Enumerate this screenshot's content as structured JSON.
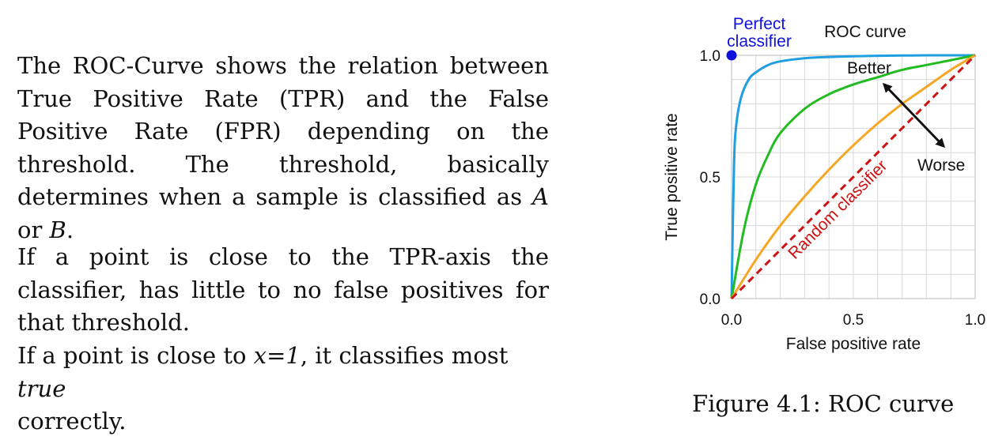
{
  "text": {
    "para1": "The ROC-Curve shows the relation between True Positive Rate (TPR) and the False Positive Rate (FPR) depending on the threshold. The threshold, basically determines when a sample is classified as",
    "para1_a": "A",
    "para1_or": "or",
    "para1_b": "B",
    "para1_end": ".",
    "para2": "If a point is close to the TPR-axis the classifier, has little to no false positives for that threshold.",
    "para3_start": "If a point is close to",
    "para3_x": "x=1",
    "para3_mid": ", it classifies most",
    "para3_true": "true",
    "para3_end": "correctly."
  },
  "figure": {
    "caption": "Figure 4.1: ROC curve"
  },
  "chart_data": {
    "type": "line",
    "title": "ROC curve",
    "xlabel": "False positive rate",
    "ylabel": "True positive rate",
    "xlim": [
      0,
      1
    ],
    "ylim": [
      0,
      1
    ],
    "xticks": [
      "0.0",
      "0.5",
      "1.0"
    ],
    "yticks": [
      "0.0",
      "0.5",
      "1.0"
    ],
    "grid": true,
    "series": [
      {
        "key": "best",
        "color": "#1f9fe0",
        "x": [
          0,
          0.01,
          0.02,
          0.04,
          0.07,
          0.1,
          0.15,
          0.2,
          0.3,
          0.4,
          0.5,
          0.6,
          0.7,
          0.8,
          0.9,
          1.0
        ],
        "y": [
          0,
          0.55,
          0.72,
          0.83,
          0.9,
          0.93,
          0.96,
          0.975,
          0.988,
          0.993,
          0.996,
          0.998,
          0.999,
          1.0,
          1.0,
          1.0
        ]
      },
      {
        "key": "good",
        "color": "#22bb22",
        "x": [
          0,
          0.05,
          0.1,
          0.15,
          0.2,
          0.3,
          0.4,
          0.5,
          0.6,
          0.7,
          0.8,
          0.9,
          1.0
        ],
        "y": [
          0,
          0.28,
          0.47,
          0.59,
          0.68,
          0.78,
          0.84,
          0.88,
          0.91,
          0.94,
          0.96,
          0.98,
          1.0
        ]
      },
      {
        "key": "fair",
        "color": "#f5a623",
        "x": [
          0,
          0.1,
          0.2,
          0.3,
          0.4,
          0.5,
          0.6,
          0.7,
          0.8,
          0.9,
          1.0
        ],
        "y": [
          0,
          0.16,
          0.3,
          0.42,
          0.53,
          0.63,
          0.72,
          0.8,
          0.87,
          0.94,
          1.0
        ]
      },
      {
        "key": "random",
        "color": "#cc1111",
        "dashed": true,
        "x": [
          0,
          1
        ],
        "y": [
          0,
          1
        ]
      }
    ],
    "perfect_point": {
      "x": 0,
      "y": 1,
      "color": "#1010dd"
    },
    "annotations": {
      "perfect": [
        "Perfect",
        "classifier"
      ],
      "better": "Better",
      "worse": "Worse",
      "random": "Random classifier"
    }
  }
}
